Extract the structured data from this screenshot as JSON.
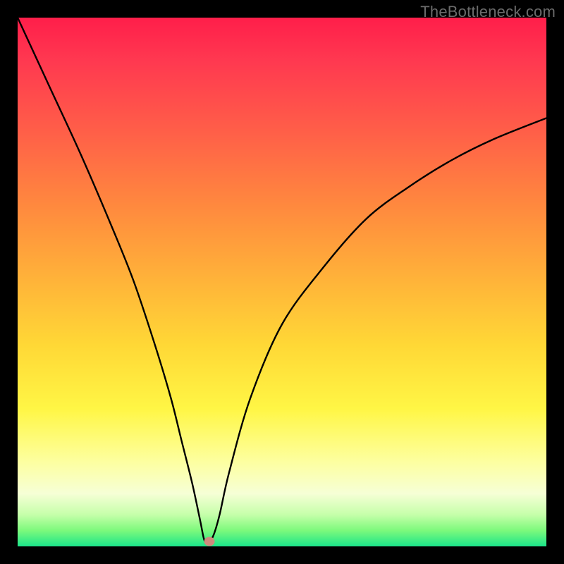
{
  "watermark": "TheBottleneck.com",
  "chart_data": {
    "type": "line",
    "title": "",
    "xlabel": "",
    "ylabel": "",
    "xlim": [
      0,
      100
    ],
    "ylim": [
      0,
      100
    ],
    "grid": false,
    "curve": {
      "x": [
        0,
        6,
        12,
        18,
        22,
        26,
        29,
        31,
        33,
        34.5,
        35.3,
        36.0,
        37.0,
        38.2,
        40,
        44,
        50,
        58,
        66,
        74,
        82,
        90,
        100
      ],
      "y_pct": [
        100,
        87,
        74,
        60,
        50,
        38,
        28,
        20,
        12,
        5,
        1.2,
        0.8,
        2.0,
        6,
        14,
        28,
        42,
        53,
        62,
        68,
        73,
        77,
        81
      ],
      "vertex_x": 35.6,
      "vertex_y_pct": 0.6
    },
    "marker": {
      "x_pct": 36.2,
      "y_pct": 0.9,
      "color": "#cf8a7d"
    },
    "gradient_stops": [
      {
        "pct": 0,
        "color": "#ff1e4a"
      },
      {
        "pct": 50,
        "color": "#ffb439"
      },
      {
        "pct": 80,
        "color": "#fdffa0"
      },
      {
        "pct": 100,
        "color": "#1be58a"
      }
    ]
  }
}
